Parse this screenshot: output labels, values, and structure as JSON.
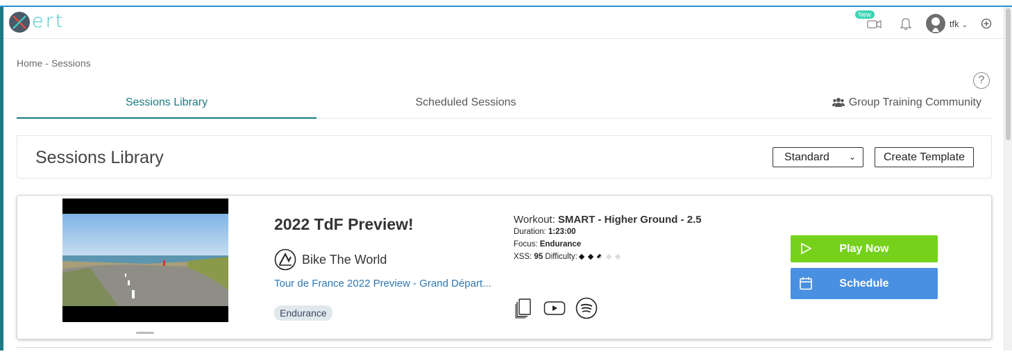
{
  "app": {
    "logo_text": "ert",
    "user_name": "tfk",
    "new_badge": "New"
  },
  "breadcrumb": {
    "home": "Home",
    "separator": " - ",
    "current": "Sessions"
  },
  "help_label": "?",
  "tabs": [
    {
      "label": "Sessions Library",
      "active": true
    },
    {
      "label": "Scheduled Sessions",
      "active": false
    },
    {
      "label": "Group Training Community",
      "active": false
    }
  ],
  "library": {
    "title": "Sessions Library",
    "view_select": "Standard",
    "create_template_label": "Create Template"
  },
  "session": {
    "title": "2022 TdF Preview!",
    "channel": "Bike The World",
    "video_title": "Tour de France 2022 Preview - Grand Départ...",
    "tag": "Endurance",
    "workout_prefix": "Workout:",
    "workout_name": "SMART - Higher Ground - 2.5",
    "duration_label": "Duration:",
    "duration": "1:23:00",
    "focus_label": "Focus:",
    "focus": "Endurance",
    "xss_label": "XSS:",
    "xss": "95",
    "difficulty_label": "Difficulty:",
    "difficulty_rating": 2.5,
    "difficulty_max": 5,
    "play_label": "Play Now",
    "schedule_label": "Schedule"
  },
  "colors": {
    "accent": "#1a7a80",
    "play": "#75d11a",
    "schedule": "#4a90e2",
    "logo": "#44c6c9",
    "tag_bg": "#dfe9ec"
  }
}
